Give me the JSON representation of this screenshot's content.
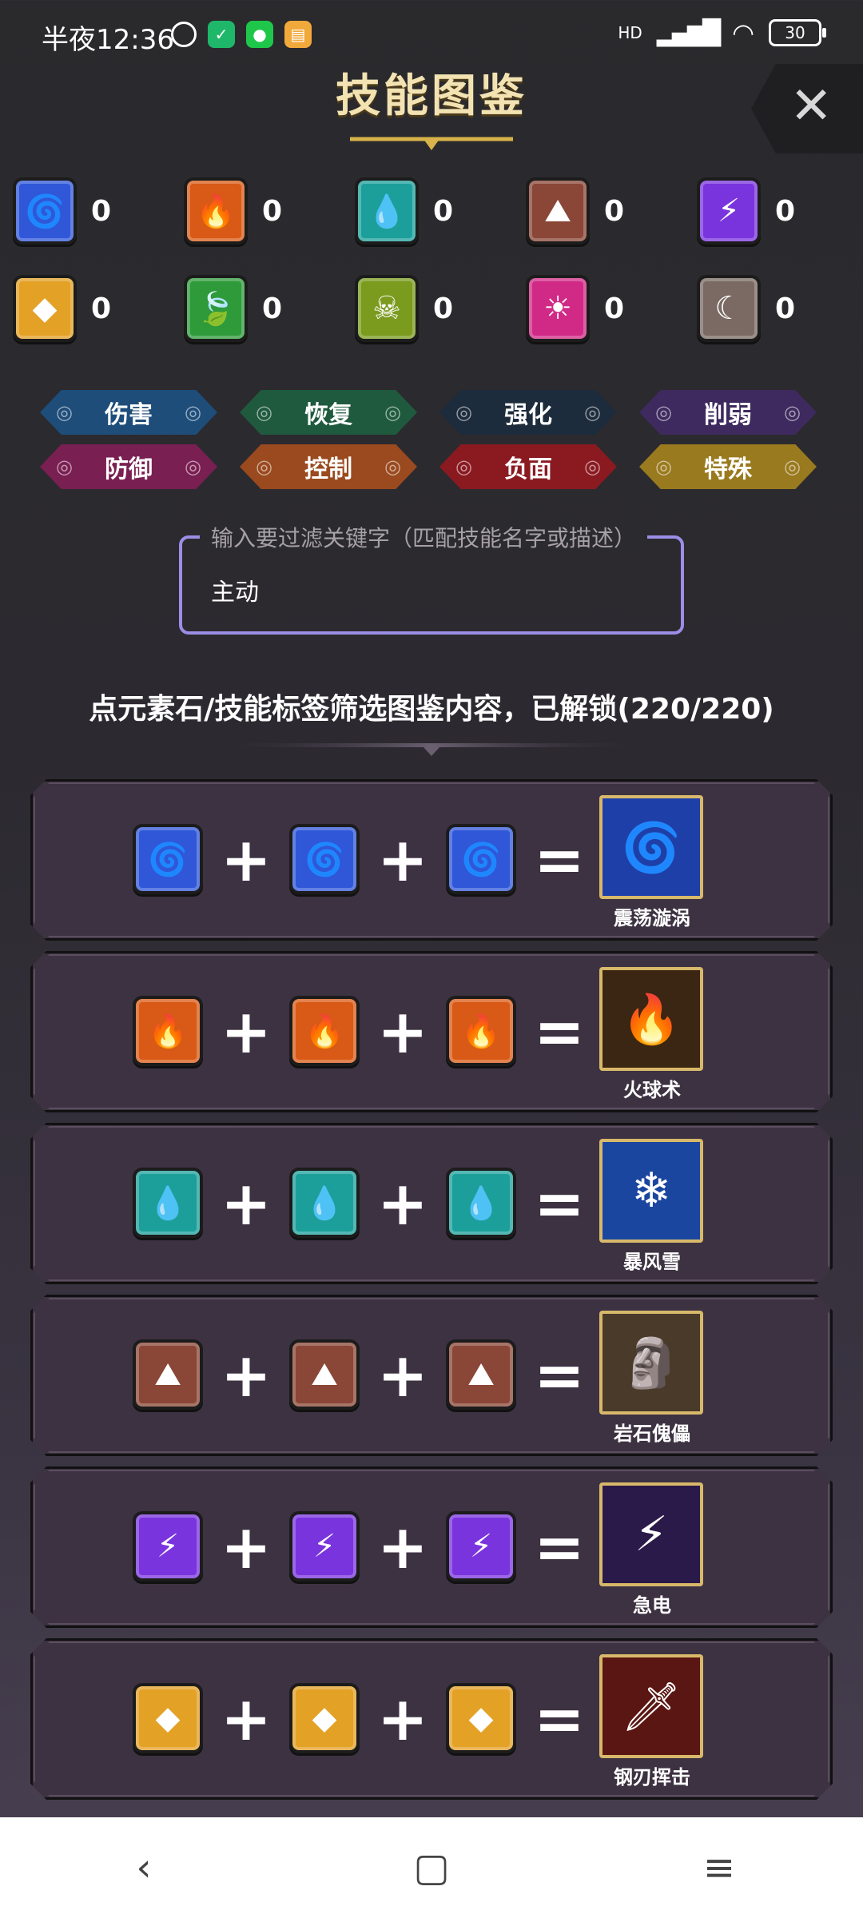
{
  "status": {
    "time": "半夜12:36",
    "battery": "30",
    "network": "HD"
  },
  "header": {
    "title": "技能图鉴",
    "close_label": "✕"
  },
  "elements": [
    {
      "name": "wind",
      "count": "0",
      "color": "#2f57d8",
      "glyph": "🌀"
    },
    {
      "name": "fire",
      "count": "0",
      "color": "#d85a16",
      "glyph": "🔥"
    },
    {
      "name": "water",
      "count": "0",
      "color": "#1c9f9a",
      "glyph": "💧"
    },
    {
      "name": "earth",
      "count": "0",
      "color": "#8a4636",
      "glyph": "⛰"
    },
    {
      "name": "lightning",
      "count": "0",
      "color": "#7a34de",
      "glyph": "⚡"
    },
    {
      "name": "light",
      "count": "0",
      "color": "#e3a126",
      "glyph": "◆"
    },
    {
      "name": "nature",
      "count": "0",
      "color": "#2e9a3a",
      "glyph": "🍃"
    },
    {
      "name": "poison",
      "count": "0",
      "color": "#7a9b1e",
      "glyph": "☠"
    },
    {
      "name": "sun",
      "count": "0",
      "color": "#d12a86",
      "glyph": "☀"
    },
    {
      "name": "moon",
      "count": "0",
      "color": "#7a6a63",
      "glyph": "☾"
    }
  ],
  "tags": [
    {
      "label": "伤害",
      "color": "#1e4d7a"
    },
    {
      "label": "恢复",
      "color": "#1f5a3e"
    },
    {
      "label": "强化",
      "color": "#1d2c3c"
    },
    {
      "label": "削弱",
      "color": "#3e2a5e"
    },
    {
      "label": "防御",
      "color": "#7a1f52"
    },
    {
      "label": "控制",
      "color": "#9a4a1e"
    },
    {
      "label": "负面",
      "color": "#8a1a20"
    },
    {
      "label": "特殊",
      "color": "#9a7a1e"
    }
  ],
  "filter": {
    "label": "输入要过滤关键字（匹配技能名字或描述）",
    "value": "主动"
  },
  "hint": "点元素石/技能标签筛选图鉴内容，已解锁(220/220)",
  "recipes": [
    {
      "element": "wind",
      "result": "震荡漩涡",
      "result_color": "#1f3fa8",
      "icon": "🌀"
    },
    {
      "element": "fire",
      "result": "火球术",
      "result_color": "#3a2612",
      "icon": "🔥"
    },
    {
      "element": "water",
      "result": "暴风雪",
      "result_color": "#1a46a0",
      "icon": "❄"
    },
    {
      "element": "earth",
      "result": "岩石傀儡",
      "result_color": "#4a3a2a",
      "icon": "🗿"
    },
    {
      "element": "lightning",
      "result": "急电",
      "result_color": "#2a1a4a",
      "icon": "⚡"
    },
    {
      "element": "light",
      "result": "钢刃挥击",
      "result_color": "#5a1612",
      "icon": "🗡"
    }
  ],
  "symbols": {
    "plus": "+",
    "equals": "="
  },
  "nav": {
    "back": "‹",
    "home": "▢",
    "menu": "≡"
  }
}
